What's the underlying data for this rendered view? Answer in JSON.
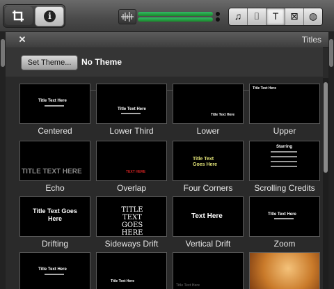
{
  "toolbar": {
    "media_buttons": [
      {
        "name": "music",
        "glyph": "♫"
      },
      {
        "name": "camera",
        "glyph": "⌷"
      },
      {
        "name": "titles",
        "glyph": "T"
      },
      {
        "name": "transitions",
        "glyph": "⊠"
      },
      {
        "name": "maps",
        "glyph": "◍"
      }
    ],
    "active": "titles"
  },
  "panel": {
    "title": "Titles",
    "set_theme_label": "Set Theme...",
    "theme_name": "No Theme"
  },
  "tiles": [
    {
      "label": "Centered",
      "preview": "Title Text Here"
    },
    {
      "label": "Lower Third",
      "preview": "Title Text Here"
    },
    {
      "label": "Lower",
      "preview": "Title Text Here"
    },
    {
      "label": "Upper",
      "preview": "Title Text Here"
    },
    {
      "label": "Echo",
      "preview": "TITLE TEXT HERE"
    },
    {
      "label": "Overlap",
      "preview": "TEXT HERE"
    },
    {
      "label": "Four Corners",
      "preview": "Title Text Goes Here"
    },
    {
      "label": "Scrolling Credits",
      "preview": "Starring"
    },
    {
      "label": "Drifting",
      "preview": "Title Text Goes Here"
    },
    {
      "label": "Sideways Drift",
      "preview": "TITLE TEXT GOES HERE"
    },
    {
      "label": "Vertical Drift",
      "preview": "Text Here"
    },
    {
      "label": "Zoom",
      "preview": "Title Text Here"
    },
    {
      "label": "",
      "preview": "Title Text Here"
    },
    {
      "label": "",
      "preview": "Title Text Here"
    },
    {
      "label": "",
      "preview": "Title Text Here"
    },
    {
      "label": "",
      "preview": ""
    }
  ],
  "colors": {
    "accent_green": "#33bb55",
    "four_corners_yellow": "#e7e87a",
    "overlap_red": "#d22222"
  }
}
